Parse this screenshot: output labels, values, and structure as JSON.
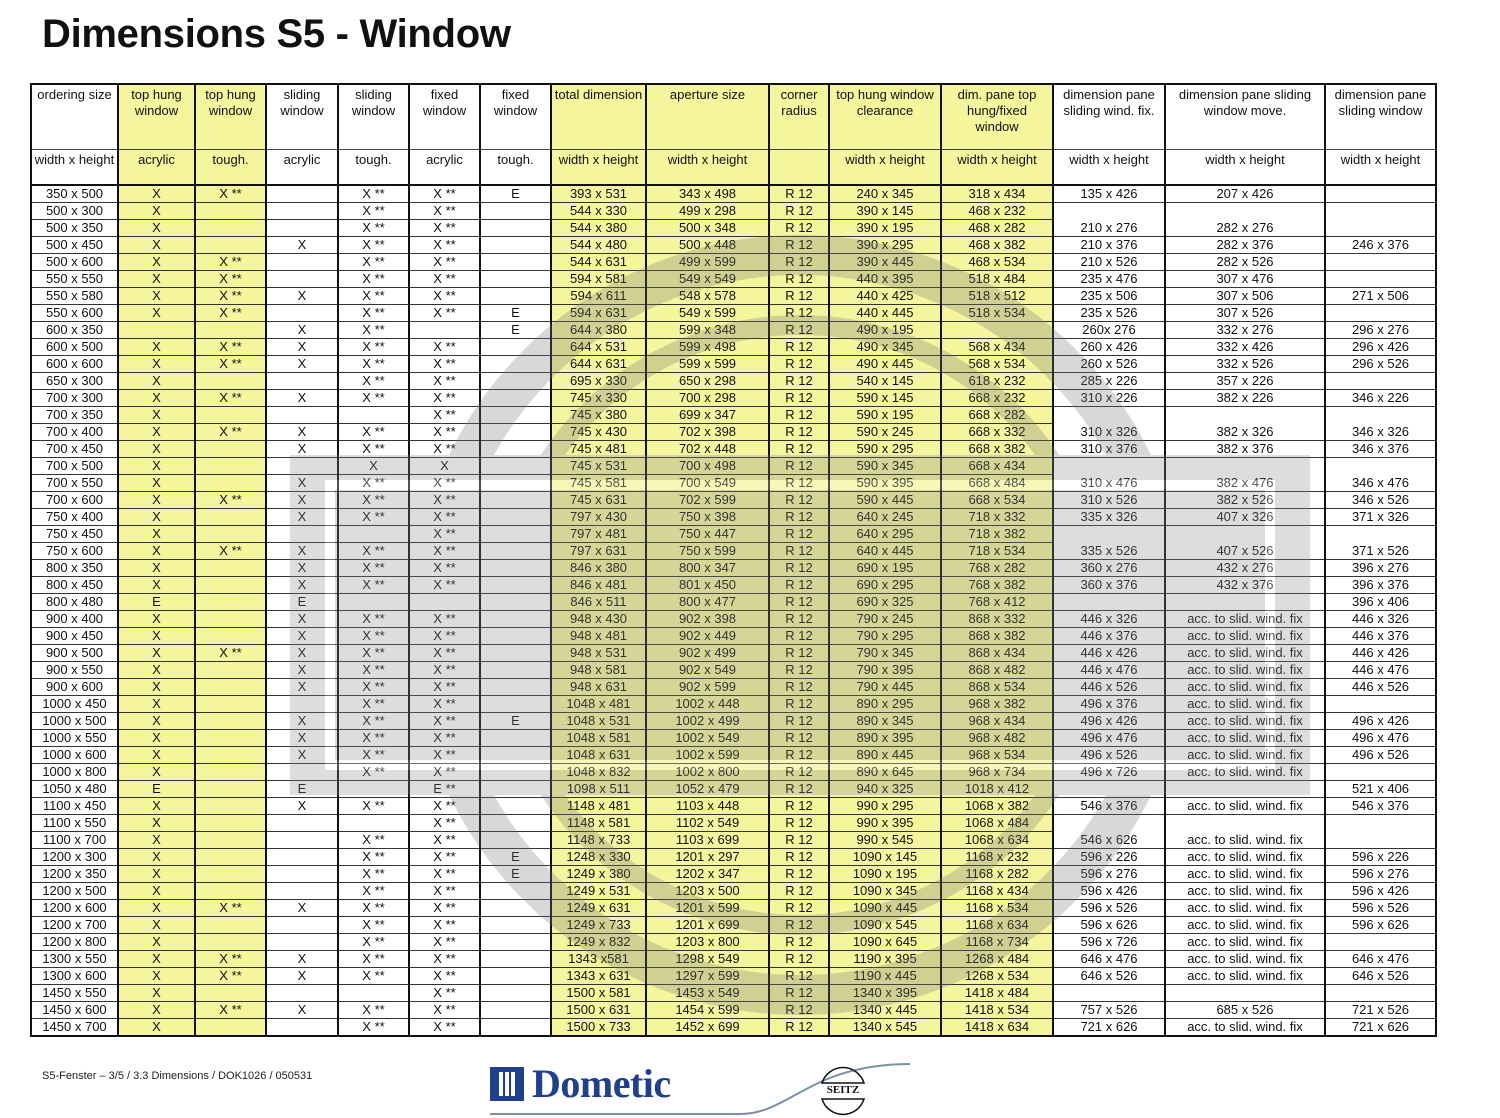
{
  "page_title": "Dimensions S5 - Window",
  "table": {
    "headers_top": [
      "ordering size",
      "top hung window",
      "top hung window",
      "sliding window",
      "sliding window",
      "fixed window",
      "fixed window",
      "total dimension",
      "aperture size",
      "corner radius",
      "top hung window clearance",
      "dim. pane top hung/fixed window",
      "dimension pane sliding wind. fix.",
      "dimension pane sliding window move.",
      "dimension pane sliding window"
    ],
    "headers_sub": [
      "width x height",
      "acrylic",
      "tough.",
      "acrylic",
      "tough.",
      "acrylic",
      "tough.",
      "width x height",
      "width x height",
      "",
      "width x height",
      "width x height",
      "width x height",
      "width x height",
      "width x height"
    ],
    "rows": [
      [
        "350 x 500",
        "X",
        "X **",
        "",
        "X **",
        "X **",
        "E",
        "393 x 531",
        "343 x 498",
        "R 12",
        "240 x 345",
        "318 x 434",
        "135 x 426",
        "207 x 426",
        ""
      ],
      [
        "500 x 300",
        "X",
        "",
        "",
        "X **",
        "X **",
        "",
        "544 x 330",
        "499 x 298",
        "R 12",
        "390 x 145",
        "468 x 232",
        "",
        "",
        ""
      ],
      [
        "500 x 350",
        "X",
        "",
        "",
        "X **",
        "X **",
        "",
        "544 x 380",
        "500 x 348",
        "R 12",
        "390 x 195",
        "468 x 282",
        "210 x 276",
        "282 x 276",
        ""
      ],
      [
        "500 x 450",
        "X",
        "",
        "X",
        "X **",
        "X **",
        "",
        "544 x 480",
        "500 x 448",
        "R 12",
        "390 x 295",
        "468 x 382",
        "210 x 376",
        "282 x 376",
        "246 x 376"
      ],
      [
        "500 x 600",
        "X",
        "X **",
        "",
        "X **",
        "X **",
        "",
        "544 x 631",
        "499 x 599",
        "R 12",
        "390 x 445",
        "468 x 534",
        "210 x 526",
        "282 x 526",
        ""
      ],
      [
        "550 x 550",
        "X",
        "X **",
        "",
        "X **",
        "X **",
        "",
        "594 x 581",
        "549 x 549",
        "R 12",
        "440 x 395",
        "518 x 484",
        "235 x 476",
        "307 x 476",
        ""
      ],
      [
        "550 x 580",
        "X",
        "X **",
        "X",
        "X **",
        "X **",
        "",
        "594 x 611",
        "548 x 578",
        "R 12",
        "440 x 425",
        "518 x 512",
        "235 x 506",
        "307 x 506",
        "271 x 506"
      ],
      [
        "550 x 600",
        "X",
        "X **",
        "",
        "X **",
        "X **",
        "E",
        "594 x 631",
        "549 x 599",
        "R 12",
        "440 x 445",
        "518 x 534",
        "235 x 526",
        "307 x 526",
        ""
      ],
      [
        "600 x 350",
        "",
        "",
        "X",
        "X **",
        "",
        "E",
        "644 x 380",
        "599 x 348",
        "R 12",
        "490 x 195",
        "",
        "260x 276",
        "332 x 276",
        "296 x 276"
      ],
      [
        "600 x 500",
        "X",
        "X **",
        "X",
        "X **",
        "X **",
        "",
        "644 x 531",
        "599 x 498",
        "R 12",
        "490 x 345",
        "568 x 434",
        "260 x 426",
        "332 x 426",
        "296 x 426"
      ],
      [
        "600 x 600",
        "X",
        "X **",
        "X",
        "X **",
        "X **",
        "",
        "644 x 631",
        "599 x 599",
        "R 12",
        "490 x 445",
        "568 x 534",
        "260 x 526",
        "332 x 526",
        "296 x 526"
      ],
      [
        "650 x 300",
        "X",
        "",
        "",
        "X **",
        "X **",
        "",
        "695 x 330",
        "650 x 298",
        "R 12",
        "540 x 145",
        "618 x 232",
        "285 x 226",
        "357 x 226",
        ""
      ],
      [
        "700 x 300",
        "X",
        "X **",
        "X",
        "X **",
        "X **",
        "",
        "745 x 330",
        "700 x 298",
        "R 12",
        "590 x 145",
        "668 x 232",
        "310 x 226",
        "382 x 226",
        "346 x 226"
      ],
      [
        "700 x 350",
        "X",
        "",
        "",
        "",
        "X **",
        "",
        "745 x 380",
        "699 x 347",
        "R 12",
        "590 x 195",
        "668 x 282",
        "",
        "",
        ""
      ],
      [
        "700 x 400",
        "X",
        "X **",
        "X",
        "X **",
        "X **",
        "",
        "745 x 430",
        "702 x 398",
        "R 12",
        "590 x 245",
        "668 x 332",
        "310 x 326",
        "382 x 326",
        "346 x 326"
      ],
      [
        "700 x 450",
        "X",
        "",
        "X",
        "X **",
        "X **",
        "",
        "745 x 481",
        "702 x 448",
        "R 12",
        "590 x 295",
        "668 x 382",
        "310 x 376",
        "382 x 376",
        "346 x 376"
      ],
      [
        "700 x 500",
        "X",
        "",
        "",
        "X",
        "X",
        "",
        "745 x 531",
        "700 x 498",
        "R 12",
        "590 x 345",
        "668 x 434",
        "",
        "",
        ""
      ],
      [
        "700 x 550",
        "X",
        "",
        "X",
        "X **",
        "X **",
        "",
        "745 x 581",
        "700 x 549",
        "R 12",
        "590 x 395",
        "668 x 484",
        "310 x 476",
        "382 x 476",
        "346 x 476"
      ],
      [
        "700 x 600",
        "X",
        "X **",
        "X",
        "X **",
        "X **",
        "",
        "745 x 631",
        "702 x 599",
        "R 12",
        "590 x 445",
        "668 x 534",
        "310 x 526",
        "382 x 526",
        "346 x 526"
      ],
      [
        "750 x 400",
        "X",
        "",
        "X",
        "X **",
        "X **",
        "",
        "797 x 430",
        "750 x 398",
        "R 12",
        "640 x 245",
        "718 x 332",
        "335 x 326",
        "407 x 326",
        "371 x 326"
      ],
      [
        "750 x 450",
        "X",
        "",
        "",
        "",
        "X **",
        "",
        "797 x 481",
        "750 x 447",
        "R 12",
        "640 x 295",
        "718 x 382",
        "",
        "",
        ""
      ],
      [
        "750 x 600",
        "X",
        "X **",
        "X",
        "X **",
        "X **",
        "",
        "797 x 631",
        "750 x 599",
        "R 12",
        "640 x 445",
        "718 x 534",
        "335 x 526",
        "407 x 526",
        "371 x 526"
      ],
      [
        "800 x 350",
        "X",
        "",
        "X",
        "X **",
        "X **",
        "",
        "846 x 380",
        "800 x 347",
        "R 12",
        "690 x 195",
        "768 x 282",
        "360 x 276",
        "432 x 276",
        "396 x 276"
      ],
      [
        "800 x 450",
        "X",
        "",
        "X",
        "X **",
        "X **",
        "",
        "846 x 481",
        "801 x 450",
        "R 12",
        "690 x 295",
        "768 x 382",
        "360 x 376",
        "432 x 376",
        "396 x 376"
      ],
      [
        "800 x 480",
        "E",
        "",
        "E",
        "",
        "",
        "",
        "846 x 511",
        "800 x 477",
        "R 12",
        "690 x 325",
        "768 x 412",
        "",
        "",
        "396 x 406"
      ],
      [
        "900 x 400",
        "X",
        "",
        "X",
        "X **",
        "X **",
        "",
        "948 x 430",
        "902 x 398",
        "R 12",
        "790 x 245",
        "868 x 332",
        "446 x 326",
        "acc. to slid. wind. fix",
        "446 x 326"
      ],
      [
        "900 x 450",
        "X",
        "",
        "X",
        "X **",
        "X **",
        "",
        "948 x 481",
        "902 x 449",
        "R 12",
        "790 x 295",
        "868 x 382",
        "446 x 376",
        "acc. to slid. wind. fix",
        "446 x 376"
      ],
      [
        "900 x 500",
        "X",
        "X **",
        "X",
        "X **",
        "X **",
        "",
        "948 x 531",
        "902 x 499",
        "R 12",
        "790 x 345",
        "868 x 434",
        "446 x 426",
        "acc. to slid. wind. fix",
        "446 x 426"
      ],
      [
        "900 x 550",
        "X",
        "",
        "X",
        "X **",
        "X **",
        "",
        "948 x 581",
        "902 x 549",
        "R 12",
        "790 x 395",
        "868 x 482",
        "446 x 476",
        "acc. to slid. wind. fix",
        "446 x 476"
      ],
      [
        "900 x 600",
        "X",
        "",
        "X",
        "X **",
        "X **",
        "",
        "948 x 631",
        "902 x 599",
        "R 12",
        "790 x 445",
        "868 x 534",
        "446 x 526",
        "acc. to slid. wind. fix",
        "446 x 526"
      ],
      [
        "1000 x 450",
        "X",
        "",
        "",
        "X **",
        "X **",
        "",
        "1048 x 481",
        "1002 x 448",
        "R 12",
        "890 x 295",
        "968 x 382",
        "496 x 376",
        "acc. to slid. wind. fix",
        ""
      ],
      [
        "1000 x 500",
        "X",
        "",
        "X",
        "X **",
        "X **",
        "E",
        "1048 x 531",
        "1002 x 499",
        "R 12",
        "890 x 345",
        "968 x 434",
        "496 x 426",
        "acc. to slid. wind. fix",
        "496 x 426"
      ],
      [
        "1000 x 550",
        "X",
        "",
        "X",
        "X **",
        "X **",
        "",
        "1048 x 581",
        "1002 x 549",
        "R 12",
        "890 x 395",
        "968 x 482",
        "496 x 476",
        "acc. to slid. wind. fix",
        "496 x 476"
      ],
      [
        "1000 x 600",
        "X",
        "",
        "X",
        "X **",
        "X **",
        "",
        "1048 x 631",
        "1002 x 599",
        "R 12",
        "890 x 445",
        "968 x 534",
        "496 x 526",
        "acc. to slid. wind. fix",
        "496 x 526"
      ],
      [
        "1000 x 800",
        "X",
        "",
        "",
        "X **",
        "X **",
        "",
        "1048 x 832",
        "1002 x 800",
        "R 12",
        "890 x 645",
        "968 x 734",
        "496 x 726",
        "acc. to slid. wind. fix",
        ""
      ],
      [
        "1050 x 480",
        "E",
        "",
        "E",
        "",
        "E **",
        "",
        "1098 x 511",
        "1052 x 479",
        "R 12",
        "940 x 325",
        "1018 x 412",
        "",
        "",
        "521 x 406"
      ],
      [
        "1100 x 450",
        "X",
        "",
        "X",
        "X **",
        "X **",
        "",
        "1148 x 481",
        "1103 x 448",
        "R 12",
        "990 x 295",
        "1068 x 382",
        "546 x 376",
        "acc. to slid. wind. fix",
        "546 x 376"
      ],
      [
        "1100 x 550",
        "X",
        "",
        "",
        "",
        "X **",
        "",
        "1148 x 581",
        "1102 x 549",
        "R 12",
        "990 x 395",
        "1068 x 484",
        "",
        "",
        ""
      ],
      [
        "1100 x 700",
        "X",
        "",
        "",
        "X **",
        "X **",
        "",
        "1148 x 733",
        "1103 x 699",
        "R 12",
        "990 x 545",
        "1068 x 634",
        "546 x 626",
        "acc. to slid. wind. fix",
        ""
      ],
      [
        "1200 x 300",
        "X",
        "",
        "",
        "X **",
        "X **",
        "E",
        "1248 x 330",
        "1201 x 297",
        "R 12",
        "1090 x 145",
        "1168 x 232",
        "596 x 226",
        "acc. to slid. wind. fix",
        "596 x 226"
      ],
      [
        "1200 x 350",
        "X",
        "",
        "",
        "X **",
        "X **",
        "E",
        "1249 x 380",
        "1202 x 347",
        "R 12",
        "1090 x 195",
        "1168 x 282",
        "596 x 276",
        "acc. to slid. wind. fix",
        "596 x 276"
      ],
      [
        "1200 x 500",
        "X",
        "",
        "",
        "X **",
        "X **",
        "",
        "1249 x 531",
        "1203 x 500",
        "R 12",
        "1090 x 345",
        "1168 x 434",
        "596 x 426",
        "acc. to slid. wind. fix",
        "596 x 426"
      ],
      [
        "1200 x 600",
        "X",
        "X **",
        "X",
        "X **",
        "X **",
        "",
        "1249 x 631",
        "1201 x 599",
        "R 12",
        "1090 x 445",
        "1168 x 534",
        "596 x 526",
        "acc. to slid. wind. fix",
        "596 x 526"
      ],
      [
        "1200 x 700",
        "X",
        "",
        "",
        "X **",
        "X **",
        "",
        "1249 x 733",
        "1201 x 699",
        "R 12",
        "1090 x 545",
        "1168 x 634",
        "596 x 626",
        "acc. to slid. wind. fix",
        "596 x 626"
      ],
      [
        "1200 x 800",
        "X",
        "",
        "",
        "X **",
        "X **",
        "",
        "1249 x 832",
        "1203 x 800",
        "R 12",
        "1090 x 645",
        "1168 x 734",
        "596 x 726",
        "acc. to slid. wind. fix",
        ""
      ],
      [
        "1300 x 550",
        "X",
        "X **",
        "X",
        "X **",
        "X **",
        "",
        "1343 x581",
        "1298 x 549",
        "R 12",
        "1190 x 395",
        "1268 x 484",
        "646 x 476",
        "acc. to slid. wind. fix",
        "646 x 476"
      ],
      [
        "1300 x 600",
        "X",
        "X **",
        "X",
        "X **",
        "X **",
        "",
        "1343 x 631",
        "1297 x 599",
        "R 12",
        "1190 x 445",
        "1268 x 534",
        "646 x 526",
        "acc. to slid. wind. fix",
        "646  x 526"
      ],
      [
        "1450 x 550",
        "X",
        "",
        "",
        "",
        "X **",
        "",
        "1500 x 581",
        "1453 x 549",
        "R 12",
        "1340 x 395",
        "1418 x 484",
        "",
        "",
        ""
      ],
      [
        "1450 x 600",
        "X",
        "X **",
        "X",
        "X **",
        "X **",
        "",
        "1500 x 631",
        "1454 x 599",
        "R 12",
        "1340 x 445",
        "1418 x 534",
        "757 x 526",
        "685 x 526",
        "721 x 526"
      ],
      [
        "1450 x 700",
        "X",
        "",
        "",
        "X **",
        "X **",
        "",
        "1500 x 733",
        "1452 x 699",
        "R 12",
        "1340 x 545",
        "1418 x 634",
        "721 x 626",
        "acc. to slid. wind. fix",
        "721 x 626"
      ]
    ]
  },
  "footer": {
    "document_ref": "S5-Fenster – 3/5  /  3.3 Dimensions  /  DOK1026 / 050531",
    "brand": "Dometic",
    "brand_secondary": "SEITZ",
    "brand_color": "#1f3f8f",
    "highlight_color": "#f4f59c"
  }
}
